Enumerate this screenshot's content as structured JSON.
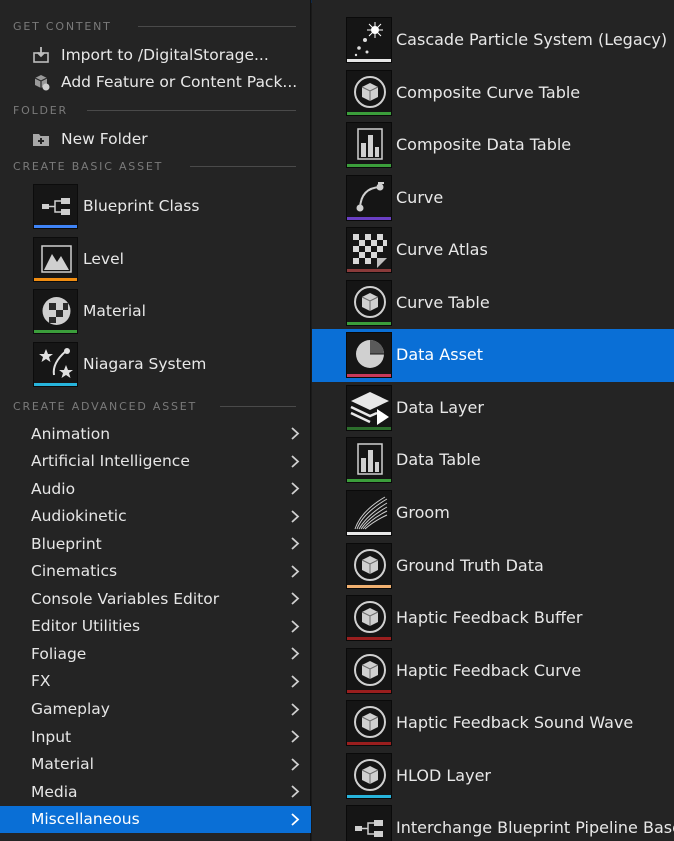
{
  "colors": {
    "selection": "#0a6fd6",
    "menu_bg": "#242424",
    "header_text": "#7a7a7a"
  },
  "left": {
    "get_content": {
      "header": "GET CONTENT",
      "items": [
        {
          "label": "Import to /DigitalStorage...",
          "icon": "import-icon"
        },
        {
          "label": "Add Feature or Content Pack...",
          "icon": "content-pack-icon"
        }
      ]
    },
    "folder": {
      "header": "FOLDER",
      "items": [
        {
          "label": "New Folder",
          "icon": "new-folder-icon"
        }
      ]
    },
    "basic": {
      "header": "CREATE BASIC ASSET",
      "items": [
        {
          "label": "Blueprint Class",
          "icon": "blueprint-class-icon",
          "color": "#3f84f7"
        },
        {
          "label": "Level",
          "icon": "level-icon",
          "color": "#f08d12"
        },
        {
          "label": "Material",
          "icon": "material-icon",
          "color": "#3b9e3b"
        },
        {
          "label": "Niagara System",
          "icon": "niagara-system-icon",
          "color": "#27b4dc"
        }
      ]
    },
    "advanced": {
      "header": "CREATE ADVANCED ASSET",
      "items": [
        {
          "label": "Animation"
        },
        {
          "label": "Artificial Intelligence"
        },
        {
          "label": "Audio"
        },
        {
          "label": "Audiokinetic"
        },
        {
          "label": "Blueprint"
        },
        {
          "label": "Cinematics"
        },
        {
          "label": "Console Variables Editor"
        },
        {
          "label": "Editor Utilities"
        },
        {
          "label": "Foliage"
        },
        {
          "label": "FX"
        },
        {
          "label": "Gameplay"
        },
        {
          "label": "Input"
        },
        {
          "label": "Material"
        },
        {
          "label": "Media"
        },
        {
          "label": "Miscellaneous",
          "selected": true
        }
      ]
    }
  },
  "right": {
    "items": [
      {
        "label": "Cascade Particle System (Legacy)",
        "icon": "particle-icon",
        "color": "#e8e8e8"
      },
      {
        "label": "Composite Curve Table",
        "icon": "cube-icon",
        "color": "#3b9e3b"
      },
      {
        "label": "Composite Data Table",
        "icon": "data-table-icon",
        "color": "#3b9e3b"
      },
      {
        "label": "Curve",
        "icon": "curve-icon",
        "color": "#6a3fc4"
      },
      {
        "label": "Curve Atlas",
        "icon": "checker-icon",
        "color": "#8a3a3a"
      },
      {
        "label": "Curve Table",
        "icon": "cube-icon",
        "color": "#3b9e3b"
      },
      {
        "label": "Data Asset",
        "icon": "pie-icon",
        "color": "#c8395a",
        "selected": true
      },
      {
        "label": "Data Layer",
        "icon": "data-layer-icon",
        "color": "#2c6e2c"
      },
      {
        "label": "Data Table",
        "icon": "data-table-icon",
        "color": "#3b9e3b"
      },
      {
        "label": "Groom",
        "icon": "groom-icon",
        "color": "#e8e8e8"
      },
      {
        "label": "Ground Truth Data",
        "icon": "cube-icon",
        "color": "#f0b070"
      },
      {
        "label": "Haptic Feedback Buffer",
        "icon": "cube-icon",
        "color": "#9a1e1e"
      },
      {
        "label": "Haptic Feedback Curve",
        "icon": "cube-icon",
        "color": "#9a1e1e"
      },
      {
        "label": "Haptic Feedback Sound Wave",
        "icon": "cube-icon",
        "color": "#9a1e1e"
      },
      {
        "label": "HLOD Layer",
        "icon": "cube-icon",
        "color": "#27b4dc"
      },
      {
        "label": "Interchange Blueprint Pipeline Base",
        "icon": "blueprint-class-icon",
        "color": "#3f84f7"
      }
    ]
  }
}
